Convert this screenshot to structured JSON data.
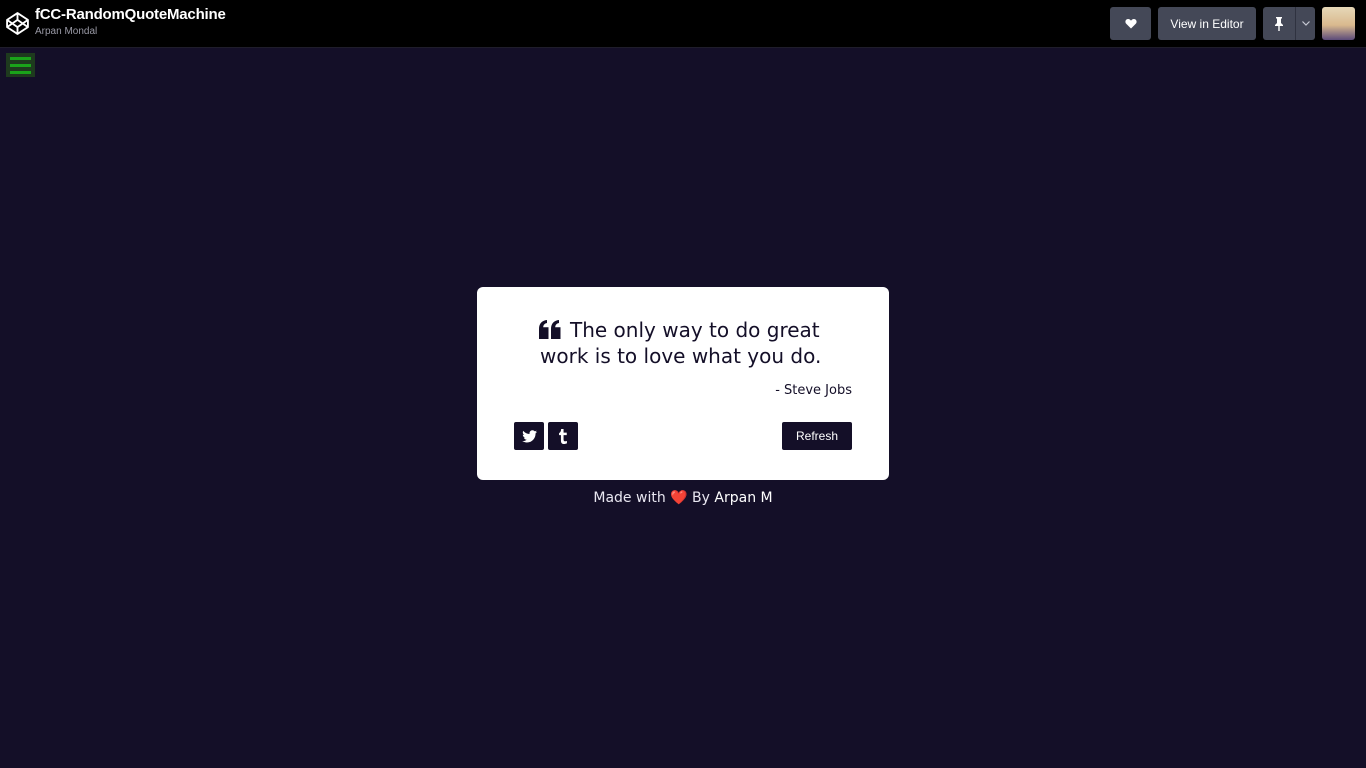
{
  "header": {
    "title": "fCC-RandomQuoteMachine",
    "author": "Arpan Mondal",
    "like_icon": "heart-icon",
    "view_in_editor_label": "View in Editor",
    "pin_icon": "pin-icon",
    "dropdown_icon": "chevron-down-icon"
  },
  "sidebar_toggle": {
    "icon": "hamburger-icon",
    "color": "#1aa31a"
  },
  "quote": {
    "text": "The only way to do great work is to love what you do.",
    "author": "- Steve Jobs",
    "icon": "quote-left-icon"
  },
  "actions": {
    "twitter_icon": "twitter-icon",
    "tumblr_icon": "tumblr-icon",
    "refresh_label": "Refresh"
  },
  "footer": {
    "prefix": "Made with",
    "heart": "❤️",
    "by": "By",
    "link_text": "Arpan M"
  },
  "colors": {
    "background": "#140f28",
    "card": "#ffffff",
    "accent": "#140f28",
    "heart": "#e0242b"
  }
}
